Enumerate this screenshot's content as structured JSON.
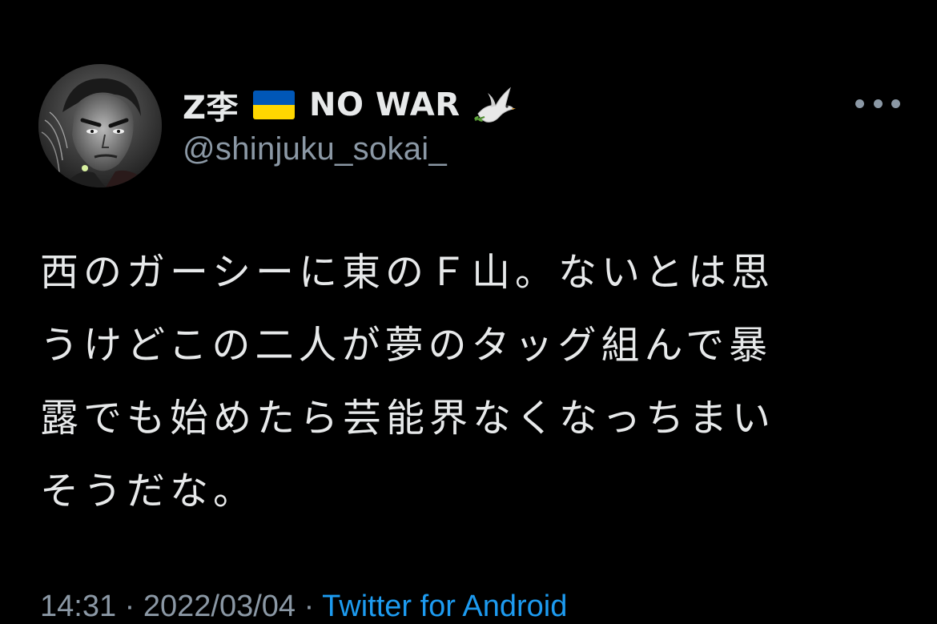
{
  "author": {
    "display_name": "Z李",
    "flag_emoji": "🇺🇦",
    "flag_colors": {
      "top": "#0057b7",
      "bottom": "#ffd700"
    },
    "war_label": "NO WAR",
    "dove_emoji": "🕊️",
    "handle": "@shinjuku_sokai_"
  },
  "actions": {
    "more_icon": "more-horizontal-icon"
  },
  "tweet": {
    "lines": [
      "西のガーシーに東のＦ山。ないとは思",
      "うけどこの二人が夢のタッグ組んで暴",
      "露でも始めたら芸能界なくなっちまい",
      "そうだな。"
    ]
  },
  "meta": {
    "timestamp": "14:31 · 2022/03/04 · ",
    "source": "Twitter for Android"
  },
  "colors": {
    "background": "#000000",
    "text_primary": "#e7e9ea",
    "text_secondary": "#8b98a5",
    "accent": "#1d9bf0"
  }
}
